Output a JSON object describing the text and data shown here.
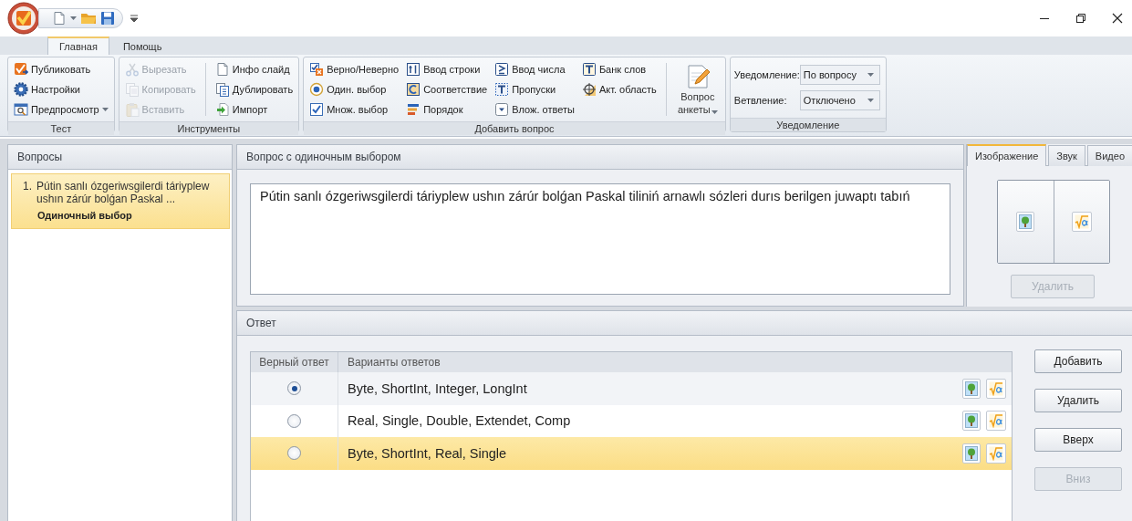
{
  "ribbon": {
    "tabs": [
      {
        "label": "Главная",
        "selected": true
      },
      {
        "label": "Помощь",
        "selected": false
      }
    ],
    "groups": [
      {
        "kind": "buttons",
        "label": "Тест",
        "columns": [
          [
            {
              "label": "Публиковать",
              "disabled": false
            },
            {
              "label": "Настройки",
              "disabled": false
            },
            {
              "label": "Предпросмотр",
              "disabled": false,
              "dropdown": true
            }
          ]
        ]
      },
      {
        "kind": "buttons",
        "label": "Инструменты",
        "columns": [
          [
            {
              "label": "Вырезать",
              "disabled": true
            },
            {
              "label": "Копировать",
              "disabled": true
            },
            {
              "label": "Вставить",
              "disabled": true
            }
          ],
          [
            {
              "label": "Инфо слайд",
              "disabled": false
            },
            {
              "label": "Дублировать",
              "disabled": false
            },
            {
              "label": "Импорт",
              "disabled": false
            }
          ]
        ]
      },
      {
        "kind": "buttons",
        "label": "Добавить вопрос",
        "columns": [
          [
            {
              "label": "Верно/Неверно",
              "disabled": false
            },
            {
              "label": "Один. выбор",
              "disabled": false
            },
            {
              "label": "Множ. выбор",
              "disabled": false
            }
          ],
          [
            {
              "label": "Ввод строки",
              "disabled": false
            },
            {
              "label": "Соответствие",
              "disabled": false
            },
            {
              "label": "Порядок",
              "disabled": false
            }
          ],
          [
            {
              "label": "Ввод числа",
              "disabled": false
            },
            {
              "label": "Пропуски",
              "disabled": false
            },
            {
              "label": "Влож. ответы",
              "disabled": false
            }
          ],
          [
            {
              "label": "Банк слов",
              "disabled": false
            },
            {
              "label": "Акт. область",
              "disabled": false
            }
          ]
        ],
        "large": {
          "label": "Вопрос анкеты",
          "dropdown": true
        }
      },
      {
        "kind": "fields",
        "label": "Уведомление",
        "fields": [
          {
            "label": "Уведомление:",
            "value": "По вопросу"
          },
          {
            "label": "Ветвление:",
            "value": "Отключено"
          }
        ]
      }
    ]
  },
  "questions": {
    "title": "Вопросы",
    "items": [
      {
        "number": "1.",
        "text": "Pútin sanlı ózgeriwsgilerdi táriyplew ushın zárúr bolǵan Paskal ...",
        "type": "Одиночный выбор",
        "selected": true
      }
    ]
  },
  "question": {
    "title": "Вопрос с одиночным выбором",
    "text": "Pútin sanlı ózgeriwsgilerdi táriyplew ushın zárúr bolǵan Paskal tiliniń arnawlı sózleri durıs berilgen juwaptı tabıń"
  },
  "media": {
    "tabs": [
      {
        "label": "Изображение",
        "selected": true
      },
      {
        "label": "Звук",
        "selected": false
      },
      {
        "label": "Видео",
        "selected": false
      }
    ],
    "delete_button": {
      "label": "Удалить",
      "disabled": true
    }
  },
  "answer": {
    "title": "Ответ",
    "columns": [
      "Верный ответ",
      "Варианты ответов"
    ],
    "rows": [
      {
        "text": "Byte, ShortInt, Integer, LongInt",
        "correct": true,
        "selected": false
      },
      {
        "text": "Real, Single, Double, Extendet, Comp",
        "correct": false,
        "selected": false
      },
      {
        "text": "Byte, ShortInt, Real, Single",
        "correct": false,
        "selected": true
      }
    ],
    "buttons": [
      {
        "label": "Добавить",
        "disabled": false
      },
      {
        "label": "Удалить",
        "disabled": false
      },
      {
        "label": "Вверх",
        "disabled": false
      },
      {
        "label": "Вниз",
        "disabled": true
      }
    ]
  }
}
